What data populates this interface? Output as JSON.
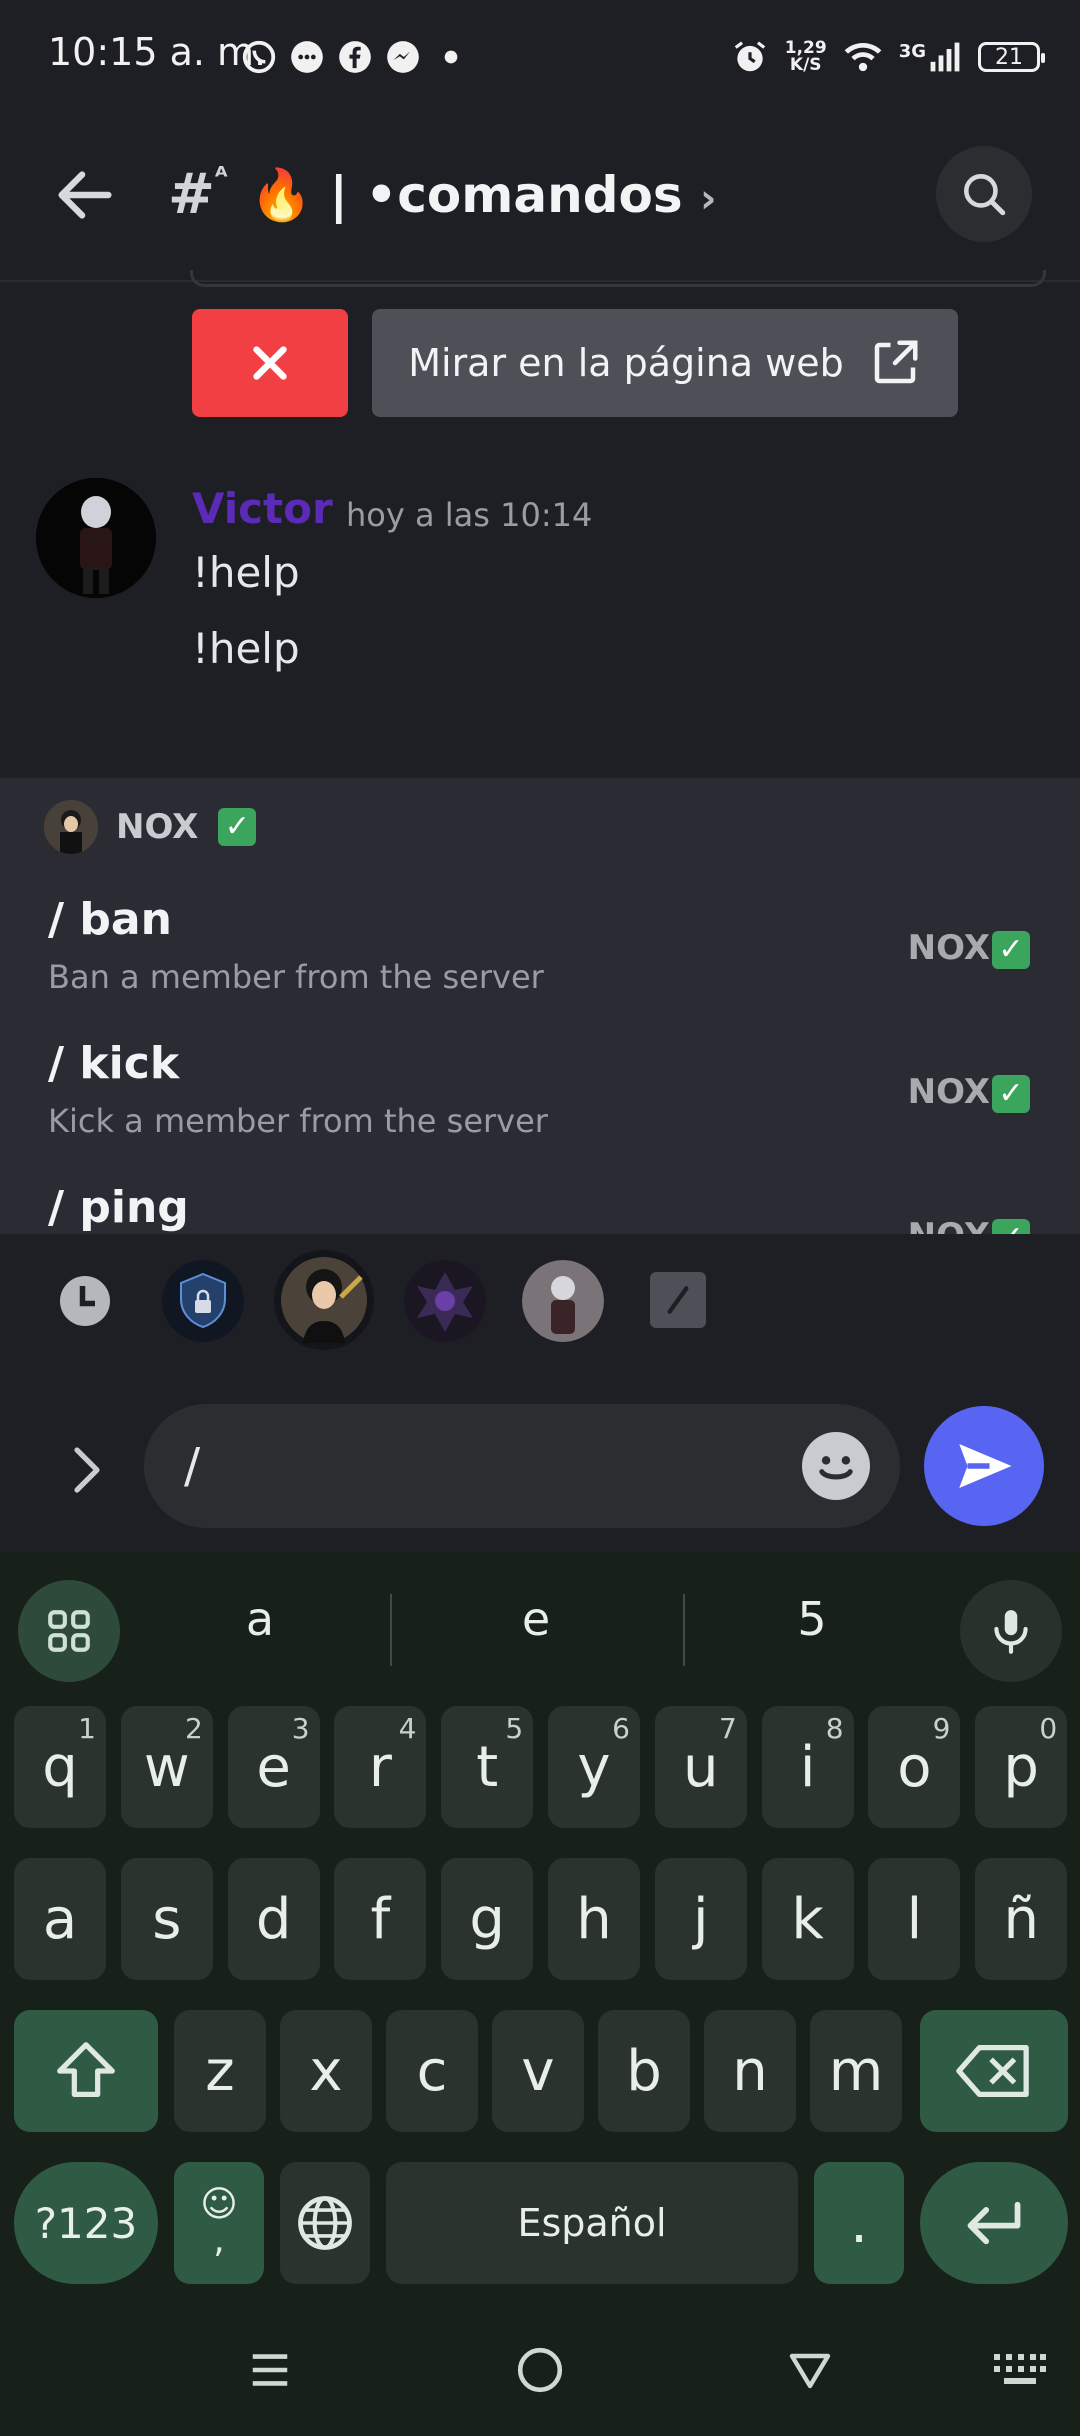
{
  "status": {
    "time": "10:15 a. m.",
    "speed_value": "1,29",
    "speed_unit": "K/S",
    "network": "3G",
    "battery": "21"
  },
  "header": {
    "channel_title": "🔥 | •comandos"
  },
  "embed_actions": {
    "web_label": "Mirar en la página web"
  },
  "message": {
    "author": "Victor",
    "time": "hoy a las 10:14",
    "lines": [
      "!help",
      "!help"
    ],
    "author_color": "#5b2bb7"
  },
  "autocomplete": {
    "bot_name": "NOX",
    "commands": [
      {
        "name": "/ ban",
        "description": "Ban a member from the server",
        "source": "NOX"
      },
      {
        "name": "/ kick",
        "description": "Kick a member from the server",
        "source": "NOX"
      },
      {
        "name": "/ ping",
        "description": "",
        "source": "NOX"
      }
    ]
  },
  "composer": {
    "input_value": "/"
  },
  "keyboard": {
    "suggestions": [
      "a",
      "e",
      "5"
    ],
    "row1": [
      {
        "k": "q",
        "h": "1"
      },
      {
        "k": "w",
        "h": "2"
      },
      {
        "k": "e",
        "h": "3"
      },
      {
        "k": "r",
        "h": "4"
      },
      {
        "k": "t",
        "h": "5"
      },
      {
        "k": "y",
        "h": "6"
      },
      {
        "k": "u",
        "h": "7"
      },
      {
        "k": "i",
        "h": "8"
      },
      {
        "k": "o",
        "h": "9"
      },
      {
        "k": "p",
        "h": "0"
      }
    ],
    "row2": [
      "a",
      "s",
      "d",
      "f",
      "g",
      "h",
      "j",
      "k",
      "l",
      "ñ"
    ],
    "row3": [
      "z",
      "x",
      "c",
      "v",
      "b",
      "n",
      "m"
    ],
    "symbols_label": "?123",
    "emoji_comma_label": ",",
    "space_label": "Español",
    "period_label": "."
  },
  "colors": {
    "accent": "#5865f2",
    "danger": "#f23f43",
    "keyboard_bg": "#172119",
    "key_special": "#2f5a44"
  }
}
